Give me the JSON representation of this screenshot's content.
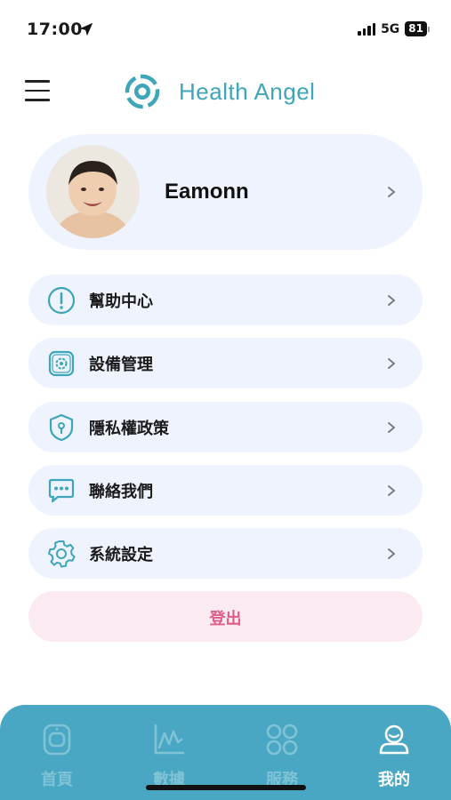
{
  "status_bar": {
    "time": "17:00",
    "network": "5G",
    "battery": "81"
  },
  "header": {
    "title": "Health Angel",
    "menu_icon": "hamburger-menu-icon",
    "logo_icon": "health-angel-logo-icon"
  },
  "profile": {
    "name": "Eamonn",
    "avatar": "baby-photo-avatar"
  },
  "menu": {
    "items": [
      {
        "label": "幫助中心",
        "icon": "help-info-icon"
      },
      {
        "label": "設備管理",
        "icon": "device-gear-icon"
      },
      {
        "label": "隱私權政策",
        "icon": "shield-lock-icon"
      },
      {
        "label": "聯絡我們",
        "icon": "chat-bubble-icon"
      },
      {
        "label": "系統設定",
        "icon": "settings-gear-icon"
      }
    ],
    "logout": "登出"
  },
  "tab_bar": {
    "tabs": [
      {
        "label": "首頁",
        "icon": "home-device-icon",
        "active": false
      },
      {
        "label": "數據",
        "icon": "data-chart-icon",
        "active": false
      },
      {
        "label": "服務",
        "icon": "services-grid-icon",
        "active": false
      },
      {
        "label": "我的",
        "icon": "profile-person-icon",
        "active": true
      }
    ]
  },
  "colors": {
    "accent": "#3ea6b8",
    "card_bg": "#eef3fe",
    "logout_bg": "#fbeaf1",
    "logout_text": "#e05d86",
    "tab_bar_bg": "#4aa7c3"
  }
}
